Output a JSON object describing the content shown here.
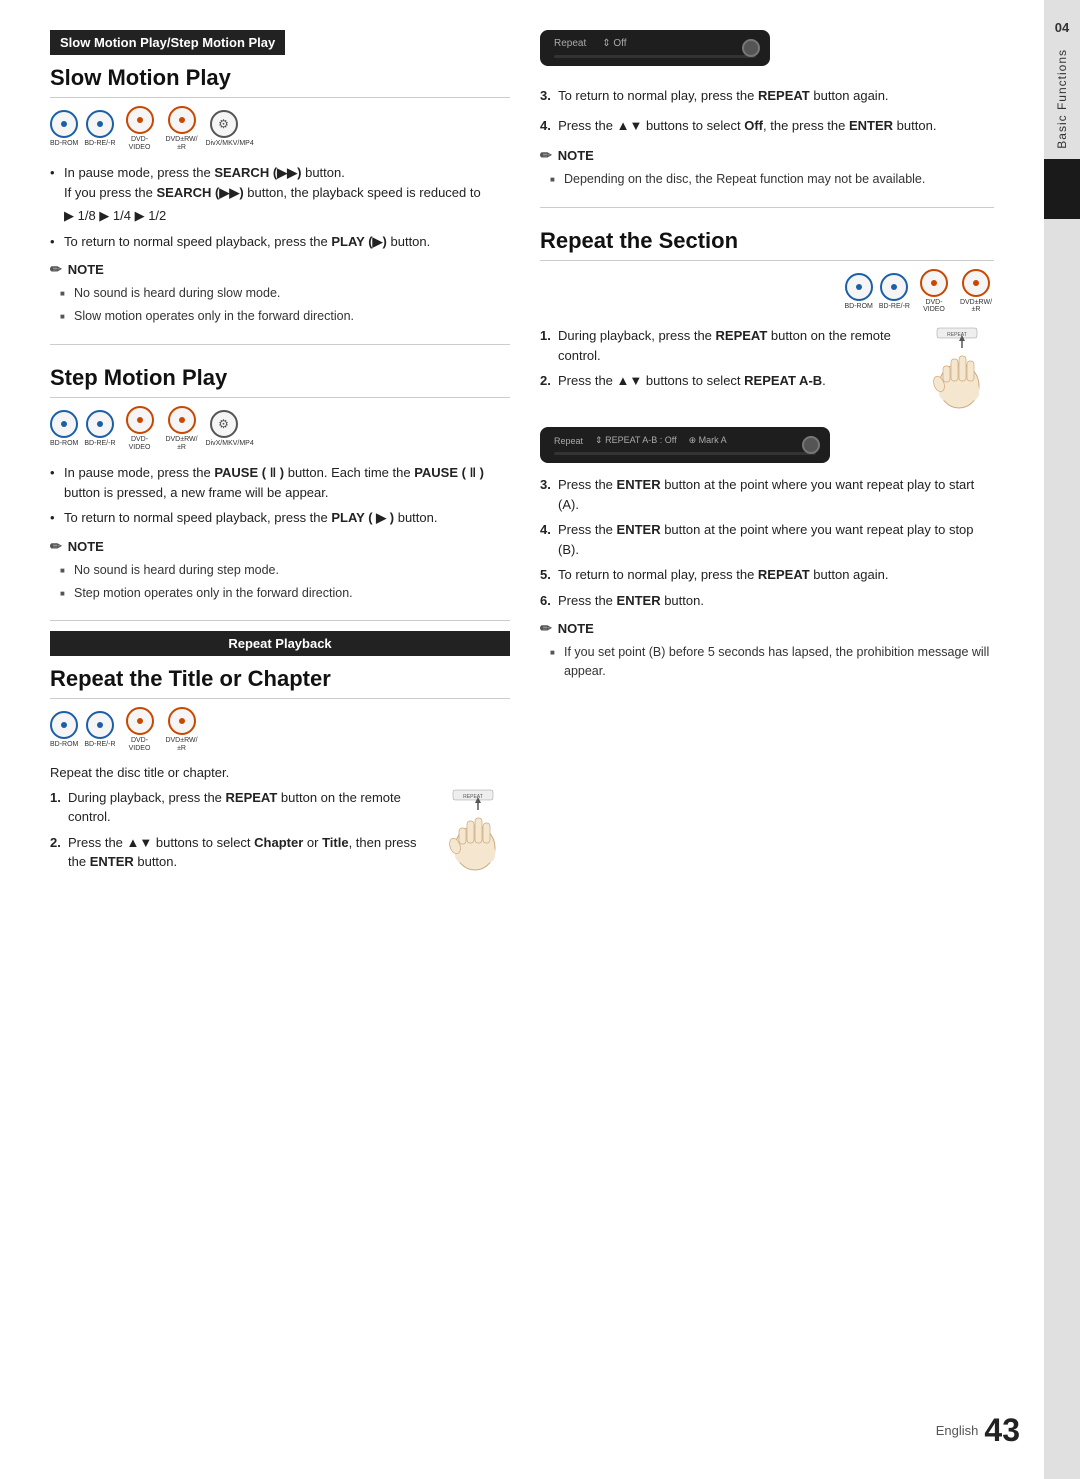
{
  "page": {
    "number": "43",
    "language": "English",
    "chapter_number": "04",
    "chapter_title": "Basic Functions"
  },
  "left_column": {
    "top_banner": "Slow Motion Play/Step Motion Play",
    "slow_motion": {
      "title": "Slow Motion Play",
      "discs": [
        {
          "label": "BD-ROM",
          "color": "blue"
        },
        {
          "label": "BD-RE/-R",
          "color": "blue"
        },
        {
          "label": "DVD-VIDEO",
          "color": "orange"
        },
        {
          "label": "DVD±RW/±R",
          "color": "orange"
        },
        {
          "label": "DivX/MKV/MP4",
          "color": "gear"
        }
      ],
      "bullets": [
        {
          "text_start": "In pause mode, press the ",
          "bold_word": "SEARCH (▶▶)",
          "text_end": " button."
        },
        {
          "sub": "If you press the SEARCH (▶▶) button, the playback speed is reduced to"
        },
        {
          "speed": "▶ 1/8 ▶ 1/4 ▶ 1/2"
        },
        {
          "text_start": "To return to normal speed playback, press the ",
          "bold_word": "PLAY (▶)",
          "text_end": " button."
        }
      ],
      "note": {
        "title": "NOTE",
        "items": [
          "No sound is heard during slow mode.",
          "Slow motion operates only in the forward direction."
        ]
      }
    },
    "step_motion": {
      "title": "Step Motion Play",
      "discs": [
        {
          "label": "BD-ROM",
          "color": "blue"
        },
        {
          "label": "BD-RE/-R",
          "color": "blue"
        },
        {
          "label": "DVD-VIDEO",
          "color": "orange"
        },
        {
          "label": "DVD±RW/±R",
          "color": "orange"
        },
        {
          "label": "DivX/MKV/MP4",
          "color": "gear"
        }
      ],
      "bullets": [
        {
          "text_start": "In pause mode, press the ",
          "bold_word": "PAUSE ( ‖ )",
          "text_end": " button. Each time the PAUSE ( ‖ ) button is pressed, a new frame will be appear."
        },
        {
          "text_start": "To return to normal speed playback, press the ",
          "bold_word": "PLAY ( ▶ )",
          "text_end": " button."
        }
      ],
      "note": {
        "title": "NOTE",
        "items": [
          "No sound is heard during step mode.",
          "Step motion operates only in the forward direction."
        ]
      }
    },
    "repeat_banner": "Repeat Playback",
    "repeat_title": {
      "title": "Repeat the Title or Chapter",
      "discs": [
        {
          "label": "BD-ROM",
          "color": "blue"
        },
        {
          "label": "BD-RE/-R",
          "color": "blue"
        },
        {
          "label": "DVD-VIDEO",
          "color": "orange"
        },
        {
          "label": "DVD±RW/±R",
          "color": "orange"
        }
      ],
      "intro": "Repeat the disc title or chapter.",
      "steps": [
        {
          "num": "1.",
          "text_start": "During playback, press the ",
          "bold_word": "REPEAT",
          "text_end": " button on the remote control."
        },
        {
          "num": "2.",
          "text_start": "Press the ▲▼ buttons to select ",
          "bold_word": "Chapter",
          "text_mid": " or ",
          "bold_word2": "Title",
          "text_end": ", then press the ",
          "bold_word3": "ENTER",
          "text_end2": " button."
        }
      ]
    }
  },
  "right_column": {
    "device_display_1": {
      "label": "Repeat",
      "value": "⇕ Off"
    },
    "step3": {
      "text_start": "To return to normal play, press the ",
      "bold_word": "REPEAT",
      "text_end": " button again."
    },
    "step4": {
      "text_start": "Press the ▲▼ buttons to select ",
      "bold_word": "Off",
      "text_mid": ", the press the ",
      "bold_word2": "ENTER",
      "text_end": " button."
    },
    "note": {
      "title": "NOTE",
      "items": [
        "Depending on the disc, the Repeat function may not be available."
      ]
    },
    "repeat_section": {
      "title": "Repeat the Section",
      "discs": [
        {
          "label": "BD-ROM",
          "color": "blue"
        },
        {
          "label": "BD-RE/-R",
          "color": "blue"
        },
        {
          "label": "DVD-VIDEO",
          "color": "orange"
        },
        {
          "label": "DVD±RW/±R",
          "color": "orange"
        }
      ],
      "steps": [
        {
          "num": "1.",
          "text_start": "During playback, press the ",
          "bold_word": "REPEAT",
          "text_end": " button on the remote control."
        },
        {
          "num": "2.",
          "text_start": "Press the ▲▼ buttons to select ",
          "bold_word": "REPEAT A-B",
          "text_end": "."
        },
        {
          "num": "3.",
          "text_start": "Press the ",
          "bold_word": "ENTER",
          "text_end": " button at the point where you want repeat play to start (A)."
        },
        {
          "num": "4.",
          "text_start": "Press the ",
          "bold_word": "ENTER",
          "text_end": " button at the point where you want repeat play to stop (B)."
        },
        {
          "num": "5.",
          "text_start": "To return to normal play, press the ",
          "bold_word": "REPEAT",
          "text_end": " button again."
        },
        {
          "num": "6.",
          "text_start": "Press the ",
          "bold_word": "ENTER",
          "text_end": " button."
        }
      ],
      "device_display": {
        "label": "Repeat",
        "value": "⇕ REPEAT A-B : Off",
        "value2": "⊕ Mark A"
      },
      "note": {
        "title": "NOTE",
        "items": [
          "If you set point (B) before 5 seconds has lapsed, the prohibition message will appear."
        ]
      }
    }
  }
}
